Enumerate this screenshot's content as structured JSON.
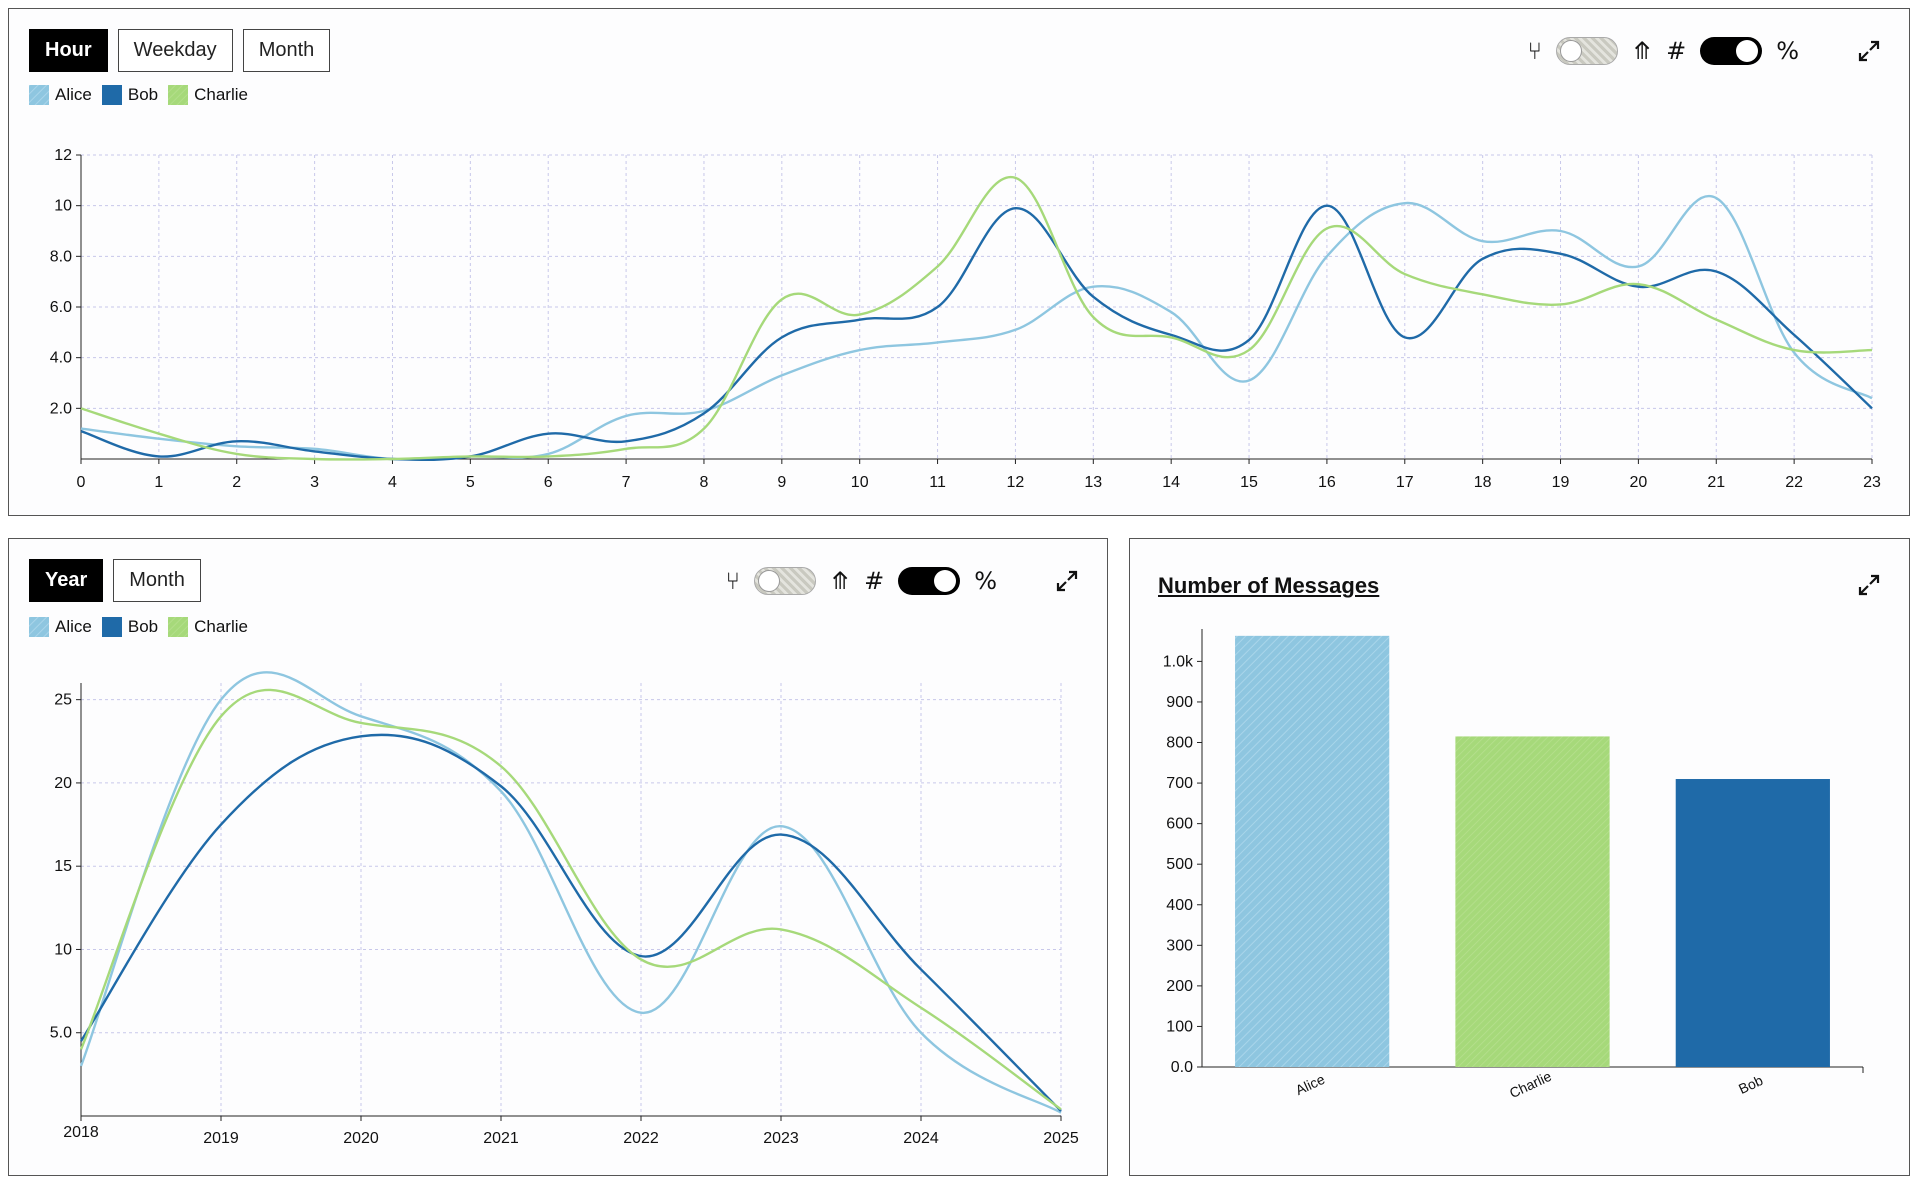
{
  "colors": {
    "alice": "#8ec6e0",
    "bob": "#1f6aa8",
    "charlie": "#a6d97a"
  },
  "legend": [
    "Alice",
    "Bob",
    "Charlie"
  ],
  "hour_panel": {
    "buttons": [
      "Hour",
      "Weekday",
      "Month"
    ],
    "active": 0,
    "tool_icons": {
      "fork": "⑂",
      "merge": "⤊",
      "hash": "#",
      "percent": "%"
    }
  },
  "year_panel": {
    "buttons": [
      "Year",
      "Month"
    ],
    "active": 0,
    "tool_icons": {
      "fork": "⑂",
      "merge": "⤊",
      "hash": "#",
      "percent": "%"
    }
  },
  "messages_panel": {
    "title": "Number of Messages"
  },
  "chart_data": [
    {
      "type": "line",
      "x": [
        0,
        1,
        2,
        3,
        4,
        5,
        6,
        7,
        8,
        9,
        10,
        11,
        12,
        13,
        14,
        15,
        16,
        17,
        18,
        19,
        20,
        21,
        22,
        23
      ],
      "xlim": [
        0,
        23
      ],
      "ylim": [
        0,
        12
      ],
      "yticks": [
        2,
        4,
        6,
        8,
        10,
        12
      ],
      "ytick_labels": [
        "2.0",
        "4.0",
        "6.0",
        "8.0",
        "10",
        "12"
      ],
      "grid": true,
      "legend_position": "top-left",
      "series": [
        {
          "name": "Alice",
          "values": [
            1.2,
            0.8,
            0.5,
            0.4,
            0.0,
            0.1,
            0.2,
            1.7,
            1.9,
            3.3,
            4.3,
            4.6,
            5.1,
            6.8,
            5.8,
            3.1,
            8.0,
            10.1,
            8.6,
            9.0,
            7.6,
            10.3,
            4.2,
            2.4
          ]
        },
        {
          "name": "Bob",
          "values": [
            1.1,
            0.1,
            0.7,
            0.3,
            0.0,
            0.1,
            1.0,
            0.7,
            1.8,
            4.8,
            5.5,
            6.0,
            9.9,
            6.4,
            4.9,
            4.7,
            10.0,
            4.8,
            7.9,
            8.1,
            6.8,
            7.4,
            4.9,
            2.0
          ]
        },
        {
          "name": "Charlie",
          "values": [
            2.0,
            1.0,
            0.2,
            0.0,
            0.0,
            0.1,
            0.1,
            0.4,
            1.2,
            6.3,
            5.7,
            7.6,
            11.1,
            5.6,
            4.8,
            4.3,
            9.1,
            7.3,
            6.5,
            6.1,
            6.9,
            5.5,
            4.3,
            4.3
          ]
        }
      ]
    },
    {
      "type": "line",
      "x": [
        2018,
        2019,
        2020,
        2021,
        2022,
        2023,
        2024,
        2025
      ],
      "xlim": [
        2018,
        2025
      ],
      "ylim": [
        0,
        26
      ],
      "yticks": [
        5,
        10,
        15,
        20,
        25
      ],
      "ytick_labels": [
        "5.0",
        "10",
        "15",
        "20",
        "25"
      ],
      "grid": true,
      "legend_position": "top-left",
      "series": [
        {
          "name": "Alice",
          "values": [
            3.0,
            25.0,
            24.0,
            19.5,
            6.2,
            17.4,
            5.0,
            0.2
          ]
        },
        {
          "name": "Bob",
          "values": [
            4.5,
            17.5,
            22.8,
            19.8,
            9.6,
            16.9,
            8.8,
            0.3
          ]
        },
        {
          "name": "Charlie",
          "values": [
            4.0,
            24.0,
            23.6,
            21.0,
            9.4,
            11.2,
            6.5,
            0.4
          ]
        }
      ]
    },
    {
      "type": "bar",
      "title": "Number of Messages",
      "categories": [
        "Alice",
        "Charlie",
        "Bob"
      ],
      "values": [
        1063,
        815,
        710
      ],
      "ylim": [
        0,
        1070
      ],
      "yticks": [
        0,
        100,
        200,
        300,
        400,
        500,
        600,
        700,
        800,
        900,
        1000
      ],
      "ytick_labels": [
        "0.0",
        "100",
        "200",
        "300",
        "400",
        "500",
        "600",
        "700",
        "800",
        "900",
        "1.0k"
      ]
    }
  ]
}
